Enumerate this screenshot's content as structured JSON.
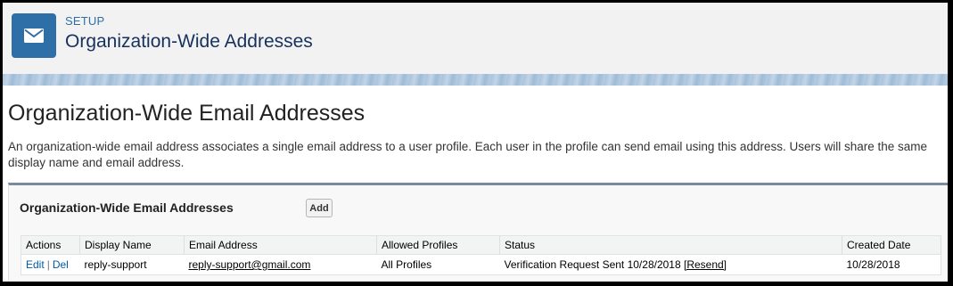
{
  "header": {
    "setup_label": "SETUP",
    "title": "Organization-Wide Addresses",
    "icon": "envelope-icon",
    "accent_color": "#2f6fa7"
  },
  "content": {
    "title": "Organization-Wide Email Addresses",
    "description": "An organization-wide email address associates a single email address to a user profile. Each user in the profile can send email using this address. Users will share the same display name and email address."
  },
  "list": {
    "title": "Organization-Wide Email Addresses",
    "add_label": "Add",
    "columns": [
      "Actions",
      "Display Name",
      "Email Address",
      "Allowed Profiles",
      "Status",
      "Created Date"
    ],
    "rows": [
      {
        "edit_label": "Edit",
        "separator": "|",
        "del_label": "Del",
        "display_name": "reply-support",
        "email": "reply-support@gmail.com",
        "allowed_profiles": "All Profiles",
        "status": "Verification Request Sent 10/28/2018",
        "resend_label": "[Resend]",
        "created_date": "10/28/2018"
      }
    ]
  }
}
